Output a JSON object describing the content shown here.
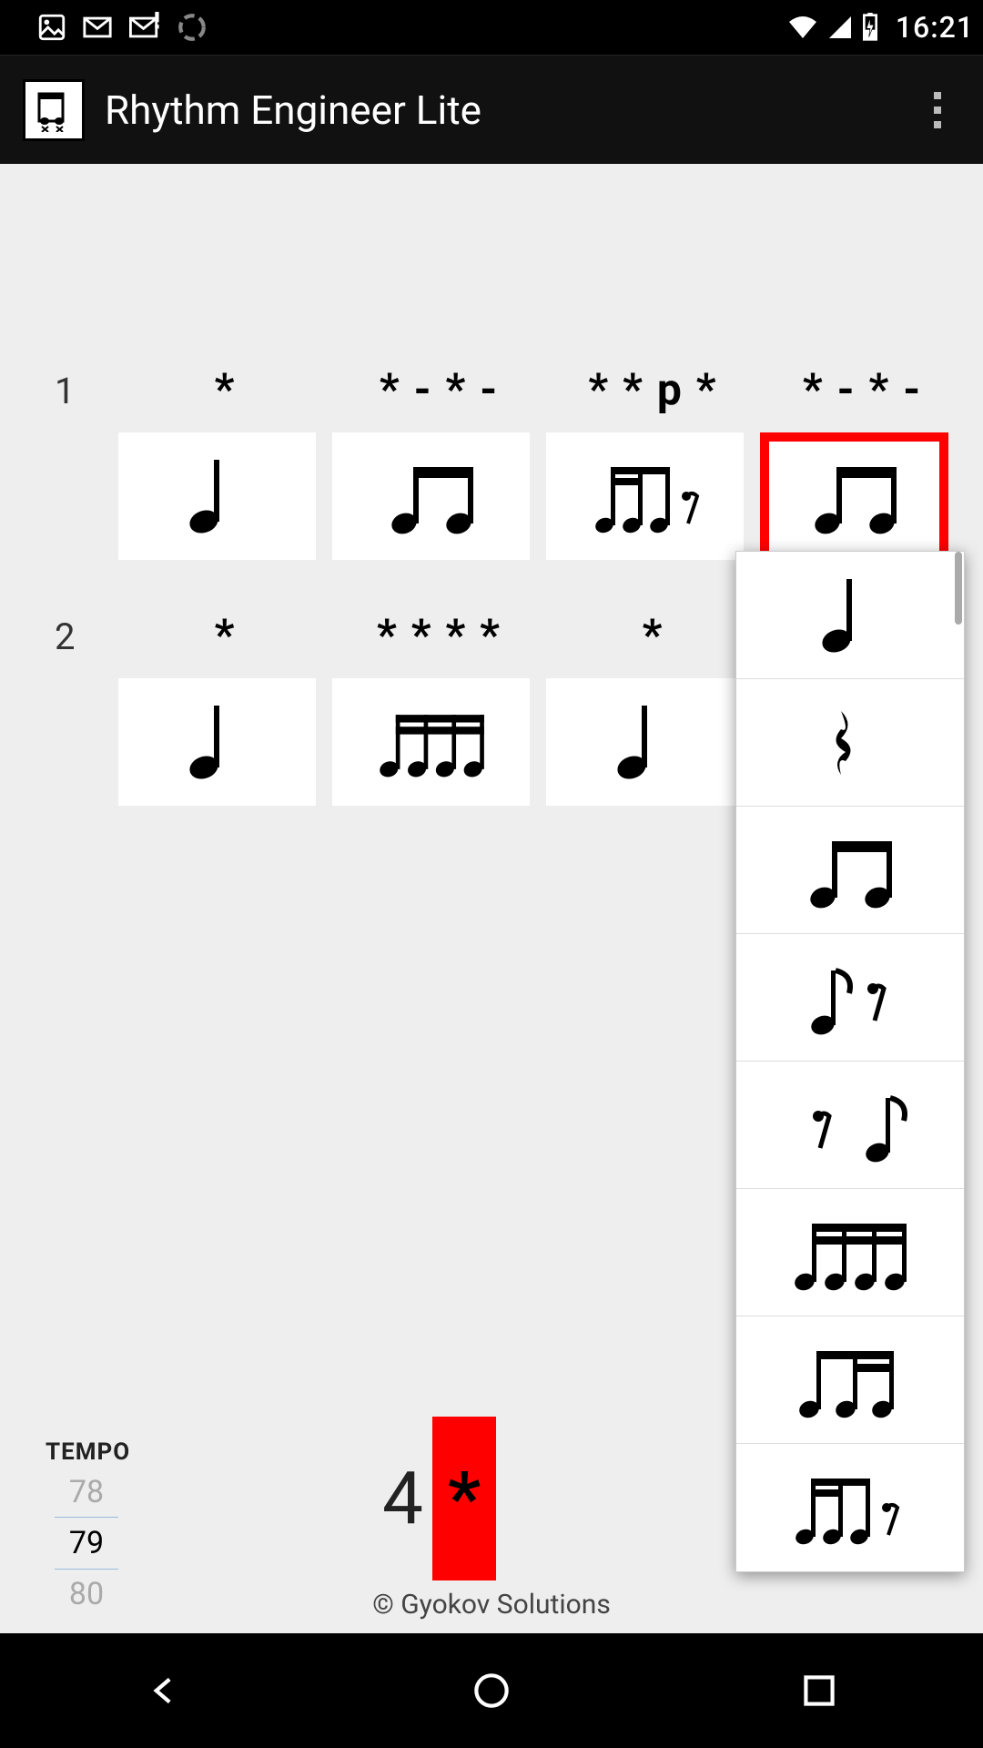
{
  "status": {
    "time": "16:21",
    "icons": [
      "image-icon",
      "gmail-icon",
      "gmail-alert-icon",
      "sync-icon"
    ],
    "right_icons": [
      "wifi-icon",
      "cell-icon",
      "battery-charging-icon"
    ]
  },
  "header": {
    "title": "Rhythm Engineer Lite"
  },
  "grid": {
    "rows": [
      {
        "num": "1",
        "cells": [
          {
            "label": "*",
            "glyph": "quarter",
            "selected": false
          },
          {
            "label": "* - * -",
            "glyph": "two-eighths",
            "selected": false
          },
          {
            "label": "* * p *",
            "glyph": "sixteen-eighth-rest",
            "selected": false
          },
          {
            "label": "* - * -",
            "glyph": "two-eighths",
            "selected": true
          }
        ]
      },
      {
        "num": "2",
        "cells": [
          {
            "label": "*",
            "glyph": "quarter",
            "selected": false
          },
          {
            "label": "* * * *",
            "glyph": "four-sixteenths",
            "selected": false
          },
          {
            "label": "*",
            "glyph": "quarter",
            "selected": false
          }
        ]
      }
    ]
  },
  "dropdown": {
    "items": [
      "quarter",
      "quarter-rest",
      "two-eighths",
      "eighth-rest8",
      "rest8-eighth",
      "four-sixteenths",
      "three-sixteenths-a",
      "sixteen-eighth-rest"
    ]
  },
  "tempo": {
    "label": "TEMPO",
    "prev": "78",
    "cur": "79",
    "next": "80"
  },
  "counter": {
    "num": "4",
    "beat": "*"
  },
  "copyright": "© Gyokov Solutions"
}
